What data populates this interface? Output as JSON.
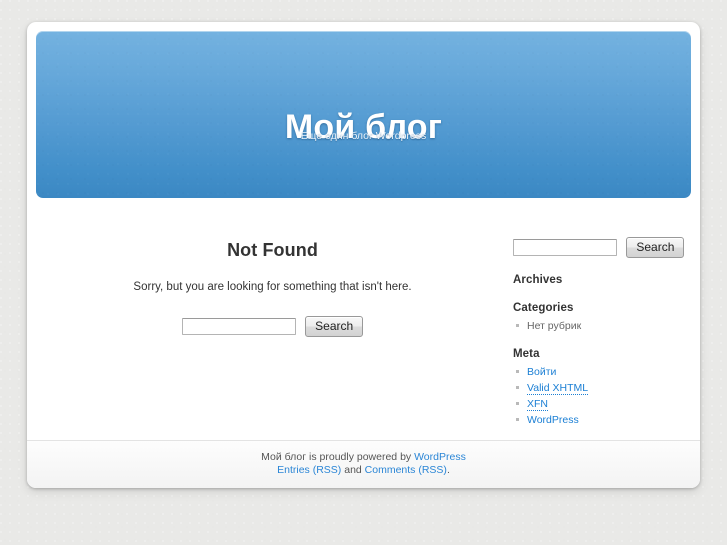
{
  "header": {
    "blog_title": "Мой блог",
    "blog_description": "Еще один блог Wordpress"
  },
  "main": {
    "not_found_title": "Not Found",
    "not_found_text": "Sorry, but you are looking for something that isn't here.",
    "search": {
      "value": "",
      "placeholder": "",
      "button_label": "Search"
    }
  },
  "sidebar": {
    "search": {
      "value": "",
      "placeholder": "",
      "button_label": "Search"
    },
    "widgets": [
      {
        "title": "Archives",
        "items": []
      },
      {
        "title": "Categories",
        "items": [
          {
            "label": "Нет рубрик",
            "is_link": false
          }
        ]
      },
      {
        "title": "Meta",
        "items": [
          {
            "label": "Войти",
            "is_link": true,
            "abbr": false
          },
          {
            "label": "Valid XHTML",
            "is_link": true,
            "abbr": true
          },
          {
            "label": "XFN",
            "is_link": true,
            "abbr": true
          },
          {
            "label": "WordPress",
            "is_link": true,
            "abbr": false
          }
        ]
      }
    ]
  },
  "footer": {
    "line1_prefix": "Мой блог is proudly powered by ",
    "line1_link": "WordPress",
    "line2_link1": "Entries (RSS)",
    "line2_middle": " and ",
    "line2_link2": "Comments (RSS)",
    "line2_suffix": "."
  },
  "colors": {
    "header_gradient_top": "#74b2e0",
    "header_gradient_bottom": "#3b88c3",
    "link": "#1b7fd4",
    "footer_link": "#2b86d6",
    "page_background": "#e9e9e7",
    "card_background": "#ffffff",
    "heading_text": "#333333"
  }
}
